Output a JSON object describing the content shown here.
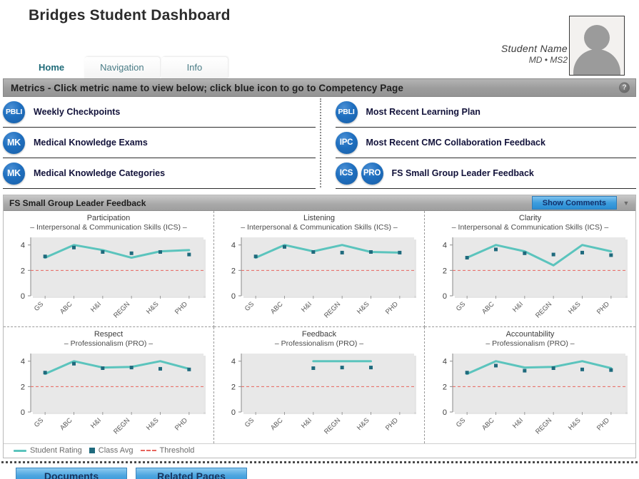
{
  "header": {
    "title": "Bridges Student Dashboard",
    "student_name": "Student Name",
    "student_program": "MD • MS2",
    "avatar_name": "avatar"
  },
  "tabs": [
    {
      "label": "Home",
      "active": true
    },
    {
      "label": "Navigation",
      "active": false
    },
    {
      "label": "Info",
      "active": false
    }
  ],
  "metrics_panel": {
    "bar_label": "Metrics - Click metric name to view below; click blue icon to go to Competency Page",
    "help_icon": "question-mark-icon",
    "left_column": [
      {
        "icons": [
          "PBLI"
        ],
        "label": "Weekly Checkpoints"
      },
      {
        "icons": [
          "MK"
        ],
        "label": "Medical Knowledge Exams"
      },
      {
        "icons": [
          "MK"
        ],
        "label": "Medical Knowledge Categories"
      }
    ],
    "right_column": [
      {
        "icons": [
          "PBLI"
        ],
        "label": "Most Recent Learning Plan"
      },
      {
        "icons": [
          "IPC"
        ],
        "label": "Most Recent CMC Collaboration Feedback"
      },
      {
        "icons": [
          "ICS",
          "PRO"
        ],
        "label": "FS Small Group Leader Feedback"
      }
    ]
  },
  "section": {
    "title": "FS Small Group Leader Feedback",
    "show_comments_label": "Show Comments",
    "caret_icon": "chevron-down-icon"
  },
  "legend": [
    {
      "label": "Student Rating",
      "type": "line",
      "color": "#5bc4bd"
    },
    {
      "label": "Class Avg",
      "type": "square",
      "color": "#1f6a7d"
    },
    {
      "label": "Threshold",
      "type": "dashed",
      "color": "#e8645c"
    }
  ],
  "footer": {
    "buttons": [
      "Documents",
      "Related Pages"
    ]
  },
  "chart_data": [
    {
      "type": "line",
      "title": "Participation",
      "subtitle": "– Interpersonal & Communication Skills (ICS) –",
      "xlabel": "",
      "ylabel": "",
      "ylim": [
        0,
        4.6
      ],
      "yticks": [
        0,
        2,
        4
      ],
      "grid": false,
      "threshold": 2,
      "categories": [
        "GS",
        "ABC",
        "H&I",
        "REGN",
        "H&S",
        "PHD"
      ],
      "series": [
        {
          "name": "Student Rating",
          "values": [
            3.0,
            4.0,
            3.6,
            3.0,
            3.5,
            3.6
          ]
        },
        {
          "name": "Class Avg",
          "values": [
            3.1,
            3.8,
            3.45,
            3.35,
            3.45,
            3.25
          ]
        }
      ]
    },
    {
      "type": "line",
      "title": "Listening",
      "subtitle": "– Interpersonal & Communication Skills (ICS) –",
      "xlabel": "",
      "ylabel": "",
      "ylim": [
        0,
        4.6
      ],
      "yticks": [
        0,
        2,
        4
      ],
      "grid": false,
      "threshold": 2,
      "categories": [
        "GS",
        "ABC",
        "H&I",
        "REGN",
        "H&S",
        "PHD"
      ],
      "series": [
        {
          "name": "Student Rating",
          "values": [
            3.0,
            4.0,
            3.5,
            4.0,
            3.45,
            3.4
          ]
        },
        {
          "name": "Class Avg",
          "values": [
            3.1,
            3.85,
            3.45,
            3.4,
            3.45,
            3.4
          ]
        }
      ]
    },
    {
      "type": "line",
      "title": "Clarity",
      "subtitle": "– Interpersonal & Communication Skills (ICS) –",
      "xlabel": "",
      "ylabel": "",
      "ylim": [
        0,
        4.6
      ],
      "yticks": [
        0,
        2,
        4
      ],
      "grid": false,
      "threshold": 2,
      "categories": [
        "GS",
        "ABC",
        "H&I",
        "REGN",
        "H&S",
        "PHD"
      ],
      "series": [
        {
          "name": "Student Rating",
          "values": [
            3.0,
            4.0,
            3.5,
            2.4,
            4.0,
            3.5
          ]
        },
        {
          "name": "Class Avg",
          "values": [
            3.0,
            3.65,
            3.35,
            3.25,
            3.4,
            3.2
          ]
        }
      ]
    },
    {
      "type": "line",
      "title": "Respect",
      "subtitle": "– Professionalism (PRO) –",
      "xlabel": "",
      "ylabel": "",
      "ylim": [
        0,
        4.6
      ],
      "yticks": [
        0,
        2,
        4
      ],
      "grid": false,
      "threshold": 2,
      "categories": [
        "GS",
        "ABC",
        "H&I",
        "REGN",
        "H&S",
        "PHD"
      ],
      "series": [
        {
          "name": "Student Rating",
          "values": [
            3.0,
            4.0,
            3.5,
            3.55,
            4.0,
            3.4
          ]
        },
        {
          "name": "Class Avg",
          "values": [
            3.1,
            3.8,
            3.45,
            3.5,
            3.4,
            3.35
          ]
        }
      ]
    },
    {
      "type": "line",
      "title": "Feedback",
      "subtitle": "– Professionalism (PRO) –",
      "xlabel": "",
      "ylabel": "",
      "ylim": [
        0,
        4.6
      ],
      "yticks": [
        0,
        2,
        4
      ],
      "grid": false,
      "threshold": 2,
      "categories": [
        "GS",
        "ABC",
        "H&I",
        "REGN",
        "H&S",
        "PHD"
      ],
      "series": [
        {
          "name": "Student Rating",
          "values": [
            null,
            null,
            4.0,
            4.0,
            4.0,
            null
          ]
        },
        {
          "name": "Class Avg",
          "values": [
            null,
            null,
            3.45,
            3.5,
            3.5,
            null
          ]
        }
      ]
    },
    {
      "type": "line",
      "title": "Accountability",
      "subtitle": "– Professionalism (PRO) –",
      "xlabel": "",
      "ylabel": "",
      "ylim": [
        0,
        4.6
      ],
      "yticks": [
        0,
        2,
        4
      ],
      "grid": false,
      "threshold": 2,
      "categories": [
        "GS",
        "ABC",
        "H&I",
        "REGN",
        "H&S",
        "PHD"
      ],
      "series": [
        {
          "name": "Student Rating",
          "values": [
            3.0,
            4.0,
            3.5,
            3.55,
            4.0,
            3.45
          ]
        },
        {
          "name": "Class Avg",
          "values": [
            3.1,
            3.65,
            3.25,
            3.45,
            3.35,
            3.3
          ]
        }
      ]
    }
  ],
  "colors": {
    "student_rating": "#5bc4bd",
    "class_avg": "#1f6a7d",
    "threshold": "#e8645c",
    "plot_bg": "#e8e8e8",
    "icon_blue": "#1f6fbf",
    "accent_button": "#3d9ddd"
  }
}
